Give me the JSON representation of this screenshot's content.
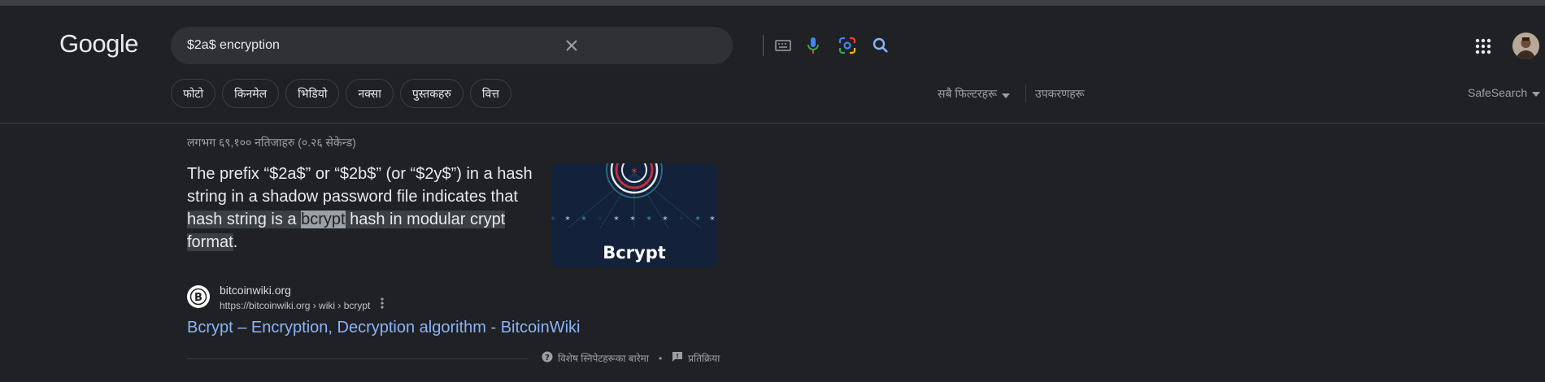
{
  "logo": {
    "text": "Google"
  },
  "search": {
    "query": "$2a$ encryption"
  },
  "chips": [
    "फोटो",
    "किनमेल",
    "भिडियो",
    "नक्सा",
    "पुस्तकहरु",
    "वित्त"
  ],
  "filters": {
    "all_filters": "सबै फिल्टरहरू",
    "tools": "उपकरणहरू",
    "safesearch": "SafeSearch"
  },
  "stats": "लगभग ६९,१०० नतिजाहरु (०.२६ सेकेन्ड)",
  "snippet": {
    "part1": "The prefix “$2a$” or “$2b$” (or “$2y$”) in a hash string in a shadow password file indicates that ",
    "hl1": "hash string is a ",
    "hl2": "bcrypt",
    "hl3": " hash in modular crypt format",
    "end": "."
  },
  "thumbnail": {
    "caption": "Bcrypt"
  },
  "source": {
    "site_name": "bitcoinwiki.org",
    "url": "https://bitcoinwiki.org › wiki › bcrypt",
    "title": "Bcrypt – Encryption, Decryption algorithm - BitcoinWiki"
  },
  "footer": {
    "about": "विशेष स्निपेटहरूका बारेमा",
    "sep": "•",
    "feedback": "प्रतिक्रिया"
  },
  "colors": {
    "background": "#202124",
    "link": "#8ab4f8",
    "text": "#e8eaed"
  }
}
